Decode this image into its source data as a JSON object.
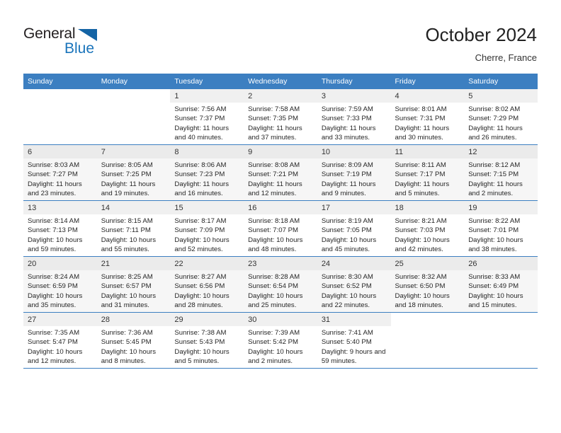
{
  "brand": {
    "name_part1": "General",
    "name_part2": "Blue",
    "triangle_color": "#1464a5",
    "blue_color": "#1a74bb"
  },
  "header": {
    "title": "October 2024",
    "subtitle": "Cherre, France"
  },
  "theme": {
    "header_row_bg": "#3c7fc1",
    "header_row_text": "#ffffff",
    "alt_row_bg": "#f6f6f6",
    "daynum_bg": "#f0f0f0"
  },
  "weekdays": [
    "Sunday",
    "Monday",
    "Tuesday",
    "Wednesday",
    "Thursday",
    "Friday",
    "Saturday"
  ],
  "labels": {
    "sunrise_prefix": "Sunrise:",
    "sunset_prefix": "Sunset:",
    "daylight_prefix": "Daylight:"
  },
  "weeks": [
    [
      {
        "day": ""
      },
      {
        "day": ""
      },
      {
        "day": "1",
        "sunrise": "Sunrise: 7:56 AM",
        "sunset": "Sunset: 7:37 PM",
        "daylight": "Daylight: 11 hours and 40 minutes."
      },
      {
        "day": "2",
        "sunrise": "Sunrise: 7:58 AM",
        "sunset": "Sunset: 7:35 PM",
        "daylight": "Daylight: 11 hours and 37 minutes."
      },
      {
        "day": "3",
        "sunrise": "Sunrise: 7:59 AM",
        "sunset": "Sunset: 7:33 PM",
        "daylight": "Daylight: 11 hours and 33 minutes."
      },
      {
        "day": "4",
        "sunrise": "Sunrise: 8:01 AM",
        "sunset": "Sunset: 7:31 PM",
        "daylight": "Daylight: 11 hours and 30 minutes."
      },
      {
        "day": "5",
        "sunrise": "Sunrise: 8:02 AM",
        "sunset": "Sunset: 7:29 PM",
        "daylight": "Daylight: 11 hours and 26 minutes."
      }
    ],
    [
      {
        "day": "6",
        "sunrise": "Sunrise: 8:03 AM",
        "sunset": "Sunset: 7:27 PM",
        "daylight": "Daylight: 11 hours and 23 minutes."
      },
      {
        "day": "7",
        "sunrise": "Sunrise: 8:05 AM",
        "sunset": "Sunset: 7:25 PM",
        "daylight": "Daylight: 11 hours and 19 minutes."
      },
      {
        "day": "8",
        "sunrise": "Sunrise: 8:06 AM",
        "sunset": "Sunset: 7:23 PM",
        "daylight": "Daylight: 11 hours and 16 minutes."
      },
      {
        "day": "9",
        "sunrise": "Sunrise: 8:08 AM",
        "sunset": "Sunset: 7:21 PM",
        "daylight": "Daylight: 11 hours and 12 minutes."
      },
      {
        "day": "10",
        "sunrise": "Sunrise: 8:09 AM",
        "sunset": "Sunset: 7:19 PM",
        "daylight": "Daylight: 11 hours and 9 minutes."
      },
      {
        "day": "11",
        "sunrise": "Sunrise: 8:11 AM",
        "sunset": "Sunset: 7:17 PM",
        "daylight": "Daylight: 11 hours and 5 minutes."
      },
      {
        "day": "12",
        "sunrise": "Sunrise: 8:12 AM",
        "sunset": "Sunset: 7:15 PM",
        "daylight": "Daylight: 11 hours and 2 minutes."
      }
    ],
    [
      {
        "day": "13",
        "sunrise": "Sunrise: 8:14 AM",
        "sunset": "Sunset: 7:13 PM",
        "daylight": "Daylight: 10 hours and 59 minutes."
      },
      {
        "day": "14",
        "sunrise": "Sunrise: 8:15 AM",
        "sunset": "Sunset: 7:11 PM",
        "daylight": "Daylight: 10 hours and 55 minutes."
      },
      {
        "day": "15",
        "sunrise": "Sunrise: 8:17 AM",
        "sunset": "Sunset: 7:09 PM",
        "daylight": "Daylight: 10 hours and 52 minutes."
      },
      {
        "day": "16",
        "sunrise": "Sunrise: 8:18 AM",
        "sunset": "Sunset: 7:07 PM",
        "daylight": "Daylight: 10 hours and 48 minutes."
      },
      {
        "day": "17",
        "sunrise": "Sunrise: 8:19 AM",
        "sunset": "Sunset: 7:05 PM",
        "daylight": "Daylight: 10 hours and 45 minutes."
      },
      {
        "day": "18",
        "sunrise": "Sunrise: 8:21 AM",
        "sunset": "Sunset: 7:03 PM",
        "daylight": "Daylight: 10 hours and 42 minutes."
      },
      {
        "day": "19",
        "sunrise": "Sunrise: 8:22 AM",
        "sunset": "Sunset: 7:01 PM",
        "daylight": "Daylight: 10 hours and 38 minutes."
      }
    ],
    [
      {
        "day": "20",
        "sunrise": "Sunrise: 8:24 AM",
        "sunset": "Sunset: 6:59 PM",
        "daylight": "Daylight: 10 hours and 35 minutes."
      },
      {
        "day": "21",
        "sunrise": "Sunrise: 8:25 AM",
        "sunset": "Sunset: 6:57 PM",
        "daylight": "Daylight: 10 hours and 31 minutes."
      },
      {
        "day": "22",
        "sunrise": "Sunrise: 8:27 AM",
        "sunset": "Sunset: 6:56 PM",
        "daylight": "Daylight: 10 hours and 28 minutes."
      },
      {
        "day": "23",
        "sunrise": "Sunrise: 8:28 AM",
        "sunset": "Sunset: 6:54 PM",
        "daylight": "Daylight: 10 hours and 25 minutes."
      },
      {
        "day": "24",
        "sunrise": "Sunrise: 8:30 AM",
        "sunset": "Sunset: 6:52 PM",
        "daylight": "Daylight: 10 hours and 22 minutes."
      },
      {
        "day": "25",
        "sunrise": "Sunrise: 8:32 AM",
        "sunset": "Sunset: 6:50 PM",
        "daylight": "Daylight: 10 hours and 18 minutes."
      },
      {
        "day": "26",
        "sunrise": "Sunrise: 8:33 AM",
        "sunset": "Sunset: 6:49 PM",
        "daylight": "Daylight: 10 hours and 15 minutes."
      }
    ],
    [
      {
        "day": "27",
        "sunrise": "Sunrise: 7:35 AM",
        "sunset": "Sunset: 5:47 PM",
        "daylight": "Daylight: 10 hours and 12 minutes."
      },
      {
        "day": "28",
        "sunrise": "Sunrise: 7:36 AM",
        "sunset": "Sunset: 5:45 PM",
        "daylight": "Daylight: 10 hours and 8 minutes."
      },
      {
        "day": "29",
        "sunrise": "Sunrise: 7:38 AM",
        "sunset": "Sunset: 5:43 PM",
        "daylight": "Daylight: 10 hours and 5 minutes."
      },
      {
        "day": "30",
        "sunrise": "Sunrise: 7:39 AM",
        "sunset": "Sunset: 5:42 PM",
        "daylight": "Daylight: 10 hours and 2 minutes."
      },
      {
        "day": "31",
        "sunrise": "Sunrise: 7:41 AM",
        "sunset": "Sunset: 5:40 PM",
        "daylight": "Daylight: 9 hours and 59 minutes."
      },
      {
        "day": ""
      },
      {
        "day": ""
      }
    ]
  ]
}
